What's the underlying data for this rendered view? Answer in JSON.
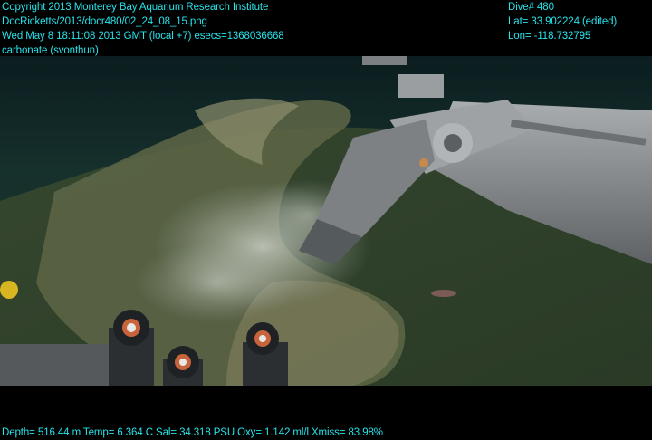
{
  "overlay_top_left": {
    "line1": "Copyright 2013 Monterey Bay Aquarium Research Institute",
    "line2": "DocRicketts/2013/docr480/02_24_08_15.png",
    "line3": "Wed May  8 18:11:08 2013 GMT (local +7)  esecs=1368036668",
    "line4": "carbonate (svonthun)"
  },
  "overlay_top_right": {
    "line1": "Dive# 480",
    "line2": "Lat= 33.902224 (edited)",
    "line3": "Lon= -118.732795"
  },
  "overlay_bottom": {
    "telemetry": "Depth= 516.44 m  Temp= 6.364 C  Sal= 34.318 PSU  Oxy= 1.142 ml/l  Xmiss= 83.98%"
  },
  "colors": {
    "overlay_text": "#27e3ea",
    "water_deep": "#0a1a1c",
    "sediment": "#3d4a2e",
    "rock": "#6f7650",
    "arm": "#8e9294",
    "plume": "#c9cec8"
  },
  "icons": [
    "manipulator-arm",
    "sampling-canister",
    "carbonate-rock",
    "sediment-plume",
    "fish"
  ]
}
